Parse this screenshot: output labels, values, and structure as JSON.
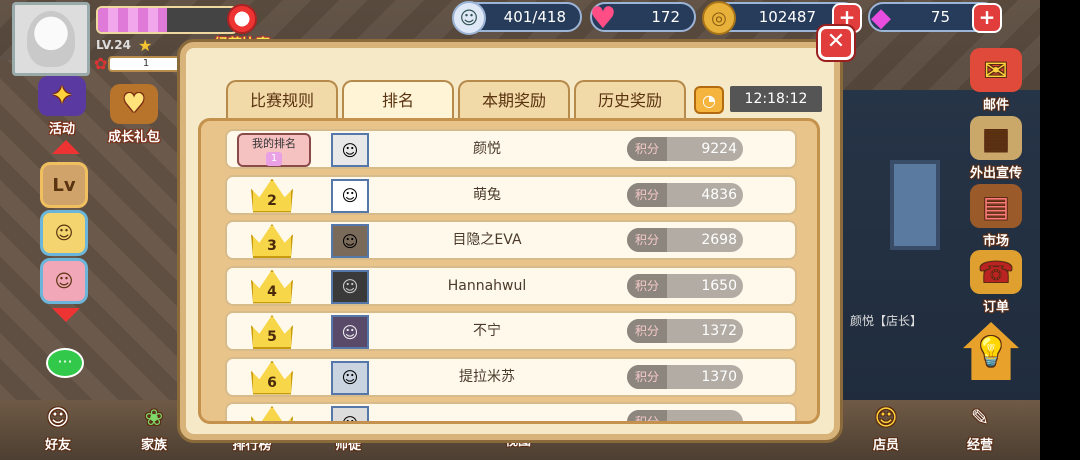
{
  "player": {
    "level": "LV.24",
    "level_value": "1",
    "xp_fill": 0.5
  },
  "contest": {
    "label": "经营比赛"
  },
  "resources": [
    {
      "name": "energy",
      "icon": "smiley-icon",
      "value": "401/418"
    },
    {
      "name": "hearts",
      "icon": "heart-icon",
      "value": "172"
    },
    {
      "name": "coins",
      "icon": "coin-icon",
      "value": "102487"
    },
    {
      "name": "gems",
      "icon": "gem-icon",
      "value": "75"
    }
  ],
  "left_menu": {
    "activity": "活动",
    "growth_gift": "成长礼包",
    "lv_slot": "Lv"
  },
  "right_menu": {
    "mail": "邮件",
    "promote": "外出宣传",
    "market": "市场",
    "orders": "订单",
    "shop_owner_name": "颜悦【店长】"
  },
  "bottom_menu": {
    "friends": "好友",
    "family": "家族",
    "leaderboard": "排行榜",
    "apprentice": "师徒",
    "view": "视图",
    "shop": "店员",
    "manage": "经营"
  },
  "dialog": {
    "tabs": [
      {
        "label": "比赛规则",
        "active": false
      },
      {
        "label": "排名",
        "active": true
      },
      {
        "label": "本期奖励",
        "active": false
      },
      {
        "label": "历史奖励",
        "active": false
      }
    ],
    "timer": "12:18:12",
    "my_rank_label": "我的排名",
    "score_label": "积分",
    "rows": [
      {
        "rank": "1",
        "name": "颜悦",
        "score": "9224",
        "is_me": true
      },
      {
        "rank": "2",
        "name": "萌兔",
        "score": "4836",
        "is_me": false
      },
      {
        "rank": "3",
        "name": "目隐之EVA",
        "score": "2698",
        "is_me": false
      },
      {
        "rank": "4",
        "name": "Hannahwul",
        "score": "1650",
        "is_me": false
      },
      {
        "rank": "5",
        "name": "不宁",
        "score": "1372",
        "is_me": false
      },
      {
        "rank": "6",
        "name": "提拉米苏",
        "score": "1370",
        "is_me": false
      }
    ]
  },
  "colors": {
    "dialog_bg": "#f6e9c8",
    "dialog_border": "#d9b47a",
    "close_red": "#e23d3d",
    "score_pill": "#b2aca5"
  }
}
